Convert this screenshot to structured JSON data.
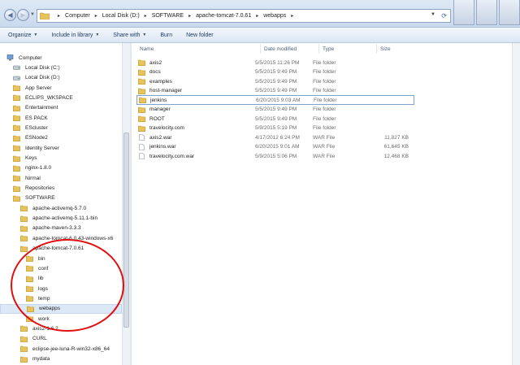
{
  "address": {
    "breadcrumbs": [
      "Computer",
      "Local Disk (D:)",
      "SOFTWARE",
      "apache-tomcat-7.0.61",
      "webapps"
    ]
  },
  "toolbar": {
    "organize": "Organize",
    "include_in_library": "Include in library",
    "share_with": "Share with",
    "burn": "Burn",
    "new_folder": "New folder"
  },
  "nav": [
    {
      "label": "Computer",
      "icon": "computer-icon",
      "indent": 0
    },
    {
      "label": "Local Disk (C:)",
      "icon": "drive-icon",
      "indent": 1
    },
    {
      "label": "Local Disk (D:)",
      "icon": "drive-icon",
      "indent": 1
    },
    {
      "label": "App Server",
      "icon": "folder-icon",
      "indent": 2
    },
    {
      "label": "ECLIPS_WKSPACE",
      "icon": "folder-icon",
      "indent": 2
    },
    {
      "label": "Entertainment",
      "icon": "folder-icon",
      "indent": 2
    },
    {
      "label": "ES PACK",
      "icon": "folder-icon",
      "indent": 2
    },
    {
      "label": "EScluster",
      "icon": "folder-icon",
      "indent": 2
    },
    {
      "label": "ESNode2",
      "icon": "folder-icon",
      "indent": 2
    },
    {
      "label": "Identity Server",
      "icon": "folder-icon",
      "indent": 2
    },
    {
      "label": "Keys",
      "icon": "folder-icon",
      "indent": 2
    },
    {
      "label": "nginx-1.8.0",
      "icon": "folder-icon",
      "indent": 2
    },
    {
      "label": "Nirmal",
      "icon": "folder-icon",
      "indent": 2
    },
    {
      "label": "Repositories",
      "icon": "folder-icon",
      "indent": 2
    },
    {
      "label": "SOFTWARE",
      "icon": "folder-icon",
      "indent": 2
    },
    {
      "label": "apache-activemq-5.7.0",
      "icon": "folder-icon",
      "indent": 3
    },
    {
      "label": "apache-activemq-5.11.1-bin",
      "icon": "folder-icon",
      "indent": 3
    },
    {
      "label": "apache-maven-3.3.3",
      "icon": "folder-icon",
      "indent": 3
    },
    {
      "label": "apache-tomcat-6.0.43-windows-x6",
      "icon": "folder-icon",
      "indent": 3
    },
    {
      "label": "apache-tomcat-7.0.61",
      "icon": "folder-icon",
      "indent": 3
    },
    {
      "label": "bin",
      "icon": "folder-icon",
      "indent": 4
    },
    {
      "label": "conf",
      "icon": "folder-icon",
      "indent": 4
    },
    {
      "label": "lib",
      "icon": "folder-icon",
      "indent": 4
    },
    {
      "label": "logs",
      "icon": "folder-icon",
      "indent": 4
    },
    {
      "label": "temp",
      "icon": "folder-icon",
      "indent": 4
    },
    {
      "label": "webapps",
      "icon": "folder-icon",
      "indent": 4,
      "selected": true
    },
    {
      "label": "work",
      "icon": "folder-icon",
      "indent": 4
    },
    {
      "label": "axis2-1.6.2",
      "icon": "folder-icon",
      "indent": 3
    },
    {
      "label": "CURL",
      "icon": "folder-icon",
      "indent": 3
    },
    {
      "label": "eclipse-jee-luna-R-win32-x86_64",
      "icon": "folder-icon",
      "indent": 3
    },
    {
      "label": "mydata",
      "icon": "folder-icon",
      "indent": 3
    }
  ],
  "columns": {
    "name": "Name",
    "date": "Date modified",
    "type": "Type",
    "size": "Size"
  },
  "files": [
    {
      "name": "axis2",
      "date": "5/5/2015 11:26 PM",
      "type": "File folder",
      "size": "",
      "icon": "folder-icon"
    },
    {
      "name": "docs",
      "date": "5/5/2015 9:49 PM",
      "type": "File folder",
      "size": "",
      "icon": "folder-icon"
    },
    {
      "name": "examples",
      "date": "5/5/2015 9:49 PM",
      "type": "File folder",
      "size": "",
      "icon": "folder-icon"
    },
    {
      "name": "host-manager",
      "date": "5/5/2015 9:49 PM",
      "type": "File folder",
      "size": "",
      "icon": "folder-icon"
    },
    {
      "name": "jenkins",
      "date": "6/20/2015 9:03 AM",
      "type": "File folder",
      "size": "",
      "icon": "folder-icon",
      "focused": true
    },
    {
      "name": "manager",
      "date": "5/5/2015 9:49 PM",
      "type": "File folder",
      "size": "",
      "icon": "folder-icon"
    },
    {
      "name": "ROOT",
      "date": "5/5/2015 9:49 PM",
      "type": "File folder",
      "size": "",
      "icon": "folder-icon"
    },
    {
      "name": "travelocity.com",
      "date": "5/9/2015 5:19 PM",
      "type": "File folder",
      "size": "",
      "icon": "folder-icon"
    },
    {
      "name": "axis2.war",
      "date": "4/17/2012 6:24 PM",
      "type": "WAR File",
      "size": "11,827 KB",
      "icon": "file-icon"
    },
    {
      "name": "jenkins.war",
      "date": "6/20/2015 9:01 AM",
      "type": "WAR File",
      "size": "61,645 KB",
      "icon": "file-icon"
    },
    {
      "name": "travelocity.com.war",
      "date": "5/9/2015 5:06 PM",
      "type": "WAR File",
      "size": "12,468 KB",
      "icon": "file-icon"
    }
  ],
  "colors": {
    "folder": "#e8c25a",
    "selection": "#dbe8f6",
    "annotation": "#e01010"
  }
}
